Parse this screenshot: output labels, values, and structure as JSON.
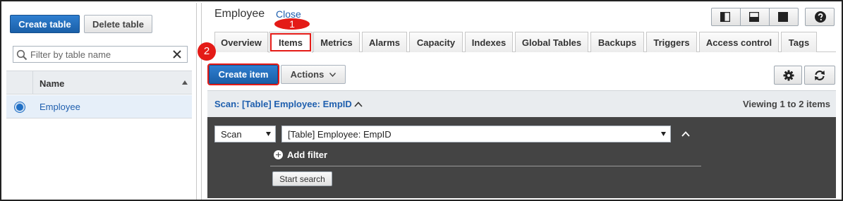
{
  "left_panel": {
    "create_table_label": "Create table",
    "delete_table_label": "Delete table",
    "filter_placeholder": "Filter by table name",
    "column_name": "Name",
    "tables": [
      "Employee"
    ]
  },
  "header": {
    "title": "Employee",
    "close_label": "Close"
  },
  "annotations": {
    "step1": "1",
    "step2": "2",
    "color": "#e41b17"
  },
  "tabs": [
    {
      "label": "Overview",
      "active": false
    },
    {
      "label": "Items",
      "active": true
    },
    {
      "label": "Metrics",
      "active": false
    },
    {
      "label": "Alarms",
      "active": false
    },
    {
      "label": "Capacity",
      "active": false
    },
    {
      "label": "Indexes",
      "active": false
    },
    {
      "label": "Global Tables",
      "active": false
    },
    {
      "label": "Backups",
      "active": false
    },
    {
      "label": "Triggers",
      "active": false
    },
    {
      "label": "Access control",
      "active": false
    },
    {
      "label": "Tags",
      "active": false
    }
  ],
  "toolbar": {
    "create_item_label": "Create item",
    "actions_label": "Actions"
  },
  "scan": {
    "title": "Scan: [Table] Employee: EmpID",
    "viewing": "Viewing 1 to 2 items",
    "mode": "Scan",
    "target": "[Table] Employee: EmpID",
    "add_filter_label": "Add filter",
    "start_search_label": "Start search"
  },
  "colors": {
    "primary": "#1a5fa8",
    "link": "#1f5fae",
    "scan_panel_bg": "#444444"
  }
}
